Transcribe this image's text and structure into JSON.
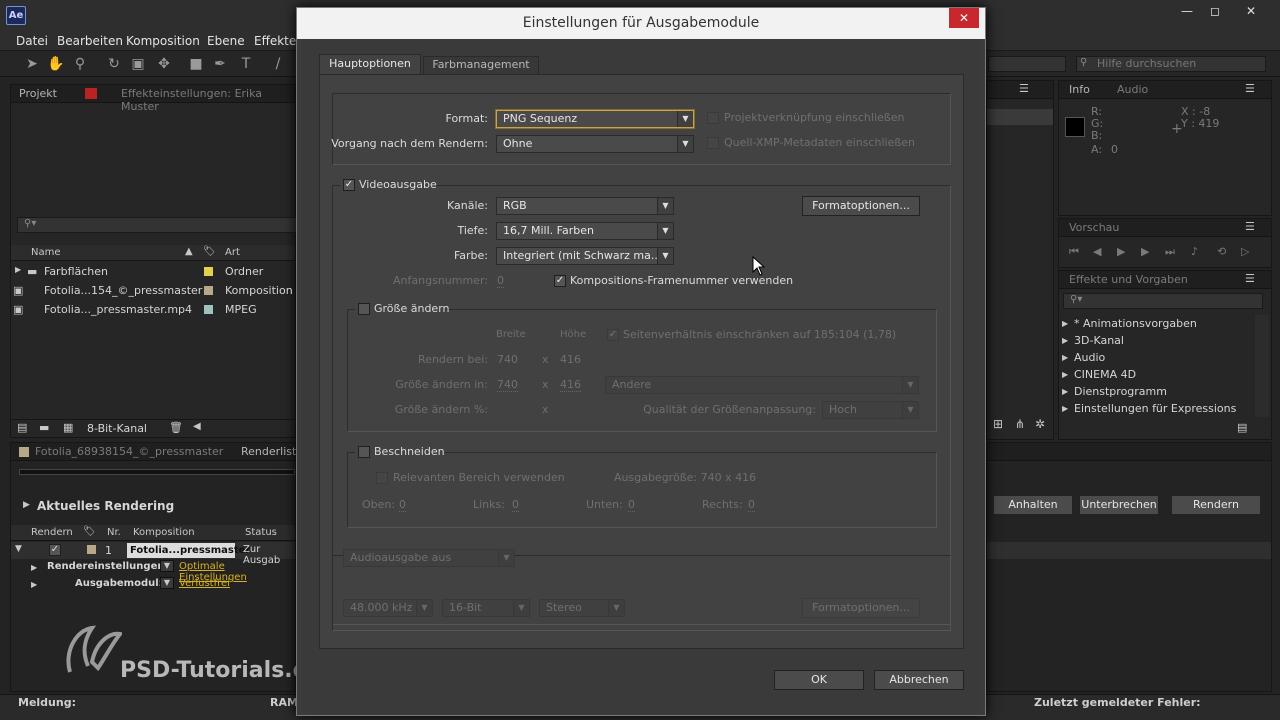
{
  "app": {
    "icon": "Ae"
  },
  "menus": [
    "Datei",
    "Bearbeiten",
    "Komposition",
    "Ebene",
    "Effekte"
  ],
  "help_search": {
    "placeholder": "Hilfe durchsuchen"
  },
  "project_panel": {
    "tabs": [
      "Projekt",
      "Effekteinstellungen: Erika Muster"
    ],
    "columns": {
      "name": "Name",
      "art": "Art"
    },
    "items": [
      {
        "name": "Farbflächen",
        "art": "Ordner",
        "color": "#e0d24a"
      },
      {
        "name": "Fotolia...154_©_pressmaster",
        "art": "Komposition",
        "color": "#b8a88a"
      },
      {
        "name": "Fotolia..._pressmaster.mp4",
        "art": "MPEG",
        "color": "#9fc2c0"
      }
    ],
    "bit_depth": "8-Bit-Kanal"
  },
  "info_panel": {
    "tabs": [
      "Info",
      "Audio"
    ],
    "r": "R:",
    "g": "G:",
    "b": "B:",
    "a": "A:",
    "a_val": "0",
    "x": "X : -8",
    "y": "Y : 419"
  },
  "preview_panel": {
    "tab": "Vorschau"
  },
  "effects_panel": {
    "tab": "Effekte und Vorgaben",
    "items": [
      "* Animationsvorgaben",
      "3D-Kanal",
      "Audio",
      "CINEMA 4D",
      "Dienstprogramm",
      "Einstellungen für Expressions"
    ]
  },
  "render_queue": {
    "tabs": [
      "Fotolia_68938154_©_pressmaster",
      "Renderliste"
    ],
    "current": "Aktuelles Rendering",
    "buttons": [
      "Anhalten",
      "Unterbrechen",
      "Rendern"
    ],
    "columns": [
      "Rendern",
      "Nr.",
      "Komposition",
      "Status"
    ],
    "row": {
      "nr": "1",
      "comp": "Fotolia...pressmaster",
      "status": "Zur Ausgab"
    },
    "render_settings_label": "Rendereinstellungen:",
    "render_settings_val": "Optimale Einstellungen",
    "output_label": "Ausgabemodul:",
    "output_val": "Verlustfrei"
  },
  "statusbar": {
    "msg": "Meldung:",
    "ram": "RAM",
    "err": "Zuletzt gemeldeter Fehler:"
  },
  "watermark": "PSD-Tutorials.de",
  "dialog": {
    "title": "Einstellungen für Ausgabemodule",
    "tabs": [
      "Hauptoptionen",
      "Farbmanagement"
    ],
    "format_label": "Format:",
    "format_val": "PNG Sequenz",
    "post_label": "Vorgang nach dem Rendern:",
    "post_val": "Ohne",
    "proj_link": "Projektverknüpfung einschließen",
    "xmp": "Quell-XMP-Metadaten einschließen",
    "video_out": "Videoausgabe",
    "channels_label": "Kanäle:",
    "channels_val": "RGB",
    "depth_label": "Tiefe:",
    "depth_val": "16,7 Mill. Farben",
    "color_label": "Farbe:",
    "color_val": "Integriert (mit Schwarz ma...",
    "start_label": "Anfangsnummer:",
    "start_val": "0",
    "comp_frame": "Kompositions-Framenummer verwenden",
    "format_opts": "Formatoptionen...",
    "resize": "Größe ändern",
    "width_h": "Breite",
    "height_h": "Höhe",
    "aspect": "Seitenverhältnis einschränken auf 185:104 (1,78)",
    "render_at": "Rendern bei:",
    "render_w": "740",
    "render_h": "416",
    "resize_to": "Größe ändern in:",
    "resize_w": "740",
    "resize_h": "416",
    "resize_preset": "Andere",
    "resize_pct": "Größe ändern %:",
    "quality_label": "Qualität der Größenanpassung:",
    "quality_val": "Hoch",
    "crop": "Beschneiden",
    "roi": "Relevanten Bereich verwenden",
    "out_size": "Ausgabegröße: 740 x 416",
    "top": "Oben:",
    "left": "Links:",
    "bottom": "Unten:",
    "right": "Rechts:",
    "zero": "0",
    "audio_out": "Audioausgabe aus",
    "khz": "48.000 kHz",
    "bit": "16-Bit",
    "stereo": "Stereo",
    "ok": "OK",
    "cancel": "Abbrechen",
    "x": "x"
  }
}
